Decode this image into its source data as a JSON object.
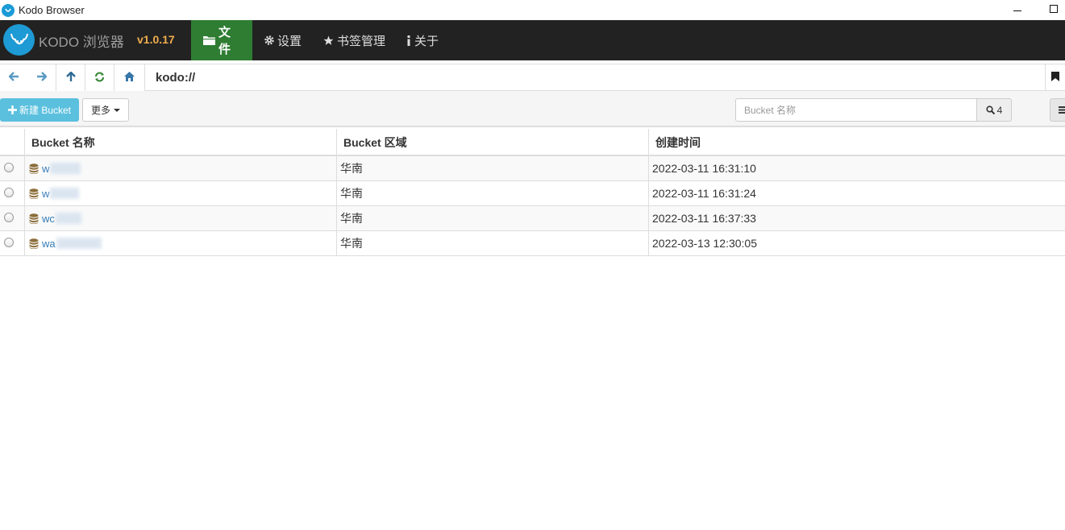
{
  "window": {
    "title": "Kodo Browser"
  },
  "navbar": {
    "brand": "KODO 浏览器",
    "version": "v1.0.17",
    "items": [
      {
        "label": "文件",
        "icon": "folder-icon",
        "active": true
      },
      {
        "label": "设置",
        "icon": "gear-icon",
        "active": false
      },
      {
        "label": "书签管理",
        "icon": "star-icon",
        "active": false
      },
      {
        "label": "关于",
        "icon": "info-icon",
        "active": false
      }
    ]
  },
  "addressbar": {
    "address": "kodo://"
  },
  "toolbar": {
    "new_bucket_label": "新建 Bucket",
    "more_label": "更多",
    "search_placeholder": "Bucket 名称",
    "search_count": "4"
  },
  "table": {
    "headers": [
      "Bucket 名称",
      "Bucket 区域",
      "创建时间"
    ],
    "rows": [
      {
        "name": "w",
        "region": "华南",
        "created": "2022-03-11 16:31:10"
      },
      {
        "name": "w",
        "region": "华南",
        "created": "2022-03-11 16:31:24"
      },
      {
        "name": "wc",
        "region": "华南",
        "created": "2022-03-11 16:37:33"
      },
      {
        "name": "wa",
        "region": "华南",
        "created": "2022-03-13 12:30:05"
      }
    ]
  },
  "colors": {
    "navbar_bg": "#222222",
    "active_tab": "#2e7d32",
    "accent": "#5bc0de",
    "version": "#f0ad4e",
    "link": "#337ab7"
  }
}
